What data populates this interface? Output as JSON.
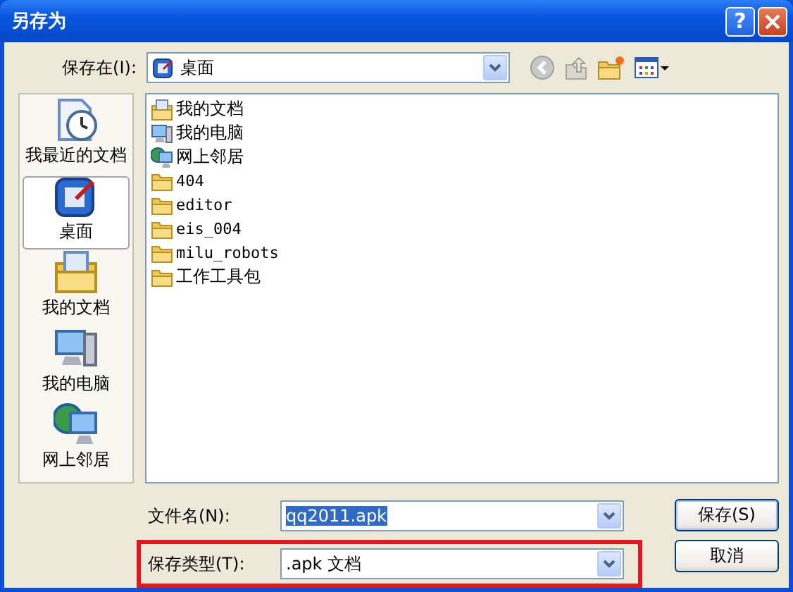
{
  "window": {
    "title": "另存为",
    "help": "?"
  },
  "save_in": {
    "label": "保存在(I):",
    "value": "桌面"
  },
  "places": [
    {
      "label": "我最近的文档",
      "kind": "recent",
      "selected": false
    },
    {
      "label": "桌面",
      "kind": "desktop",
      "selected": true
    },
    {
      "label": "我的文档",
      "kind": "documents",
      "selected": false
    },
    {
      "label": "我的电脑",
      "kind": "computer",
      "selected": false
    },
    {
      "label": "网上邻居",
      "kind": "network",
      "selected": false
    }
  ],
  "files": [
    {
      "name": "我的文档",
      "kind": "documents"
    },
    {
      "name": "我的电脑",
      "kind": "computer"
    },
    {
      "name": "网上邻居",
      "kind": "network"
    },
    {
      "name": "404",
      "kind": "folder"
    },
    {
      "name": "editor",
      "kind": "folder"
    },
    {
      "name": "eis_004",
      "kind": "folder"
    },
    {
      "name": "milu_robots",
      "kind": "folder"
    },
    {
      "name": "工作工具包",
      "kind": "folder"
    }
  ],
  "fields": [
    {
      "label": "文件名(N):",
      "value": "qq2011.apk",
      "value_selected": true,
      "highlighted": false
    },
    {
      "label": "保存类型(T):",
      "value": ".apk 文档",
      "value_selected": false,
      "highlighted": true
    }
  ],
  "buttons": [
    "保存(S)",
    "取消"
  ]
}
